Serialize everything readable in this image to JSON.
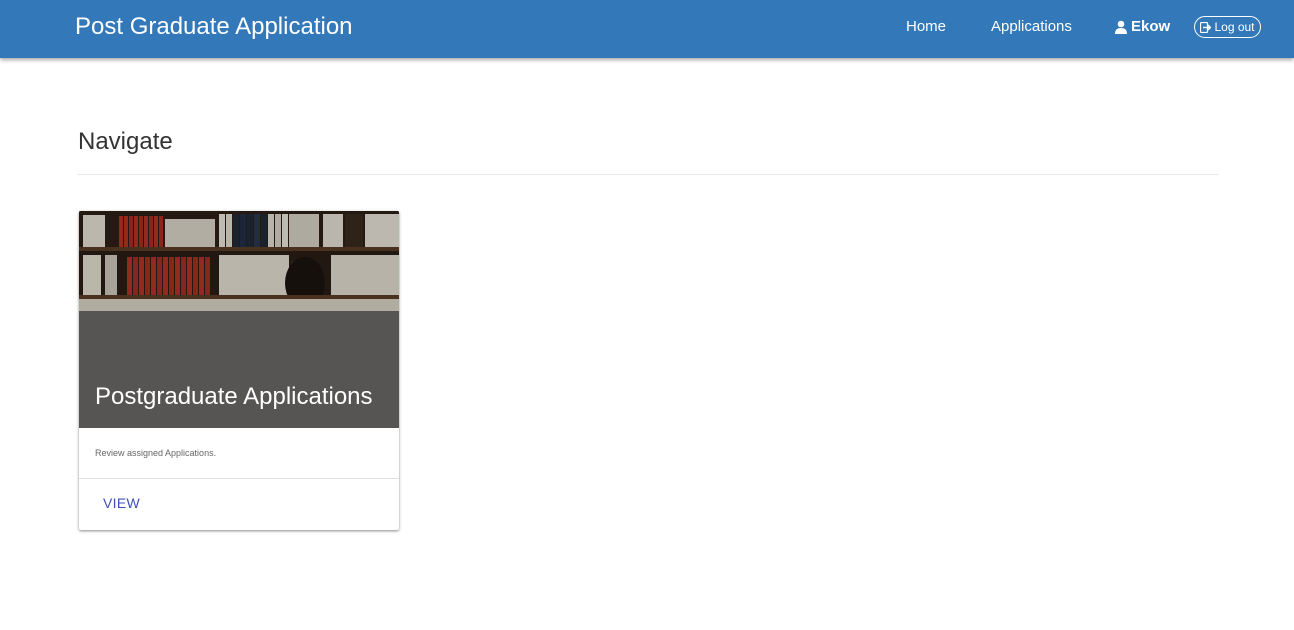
{
  "header": {
    "brand": "Post Graduate Application",
    "nav": {
      "home": "Home",
      "applications": "Applications",
      "user": "Ekow",
      "logout": "Log out"
    },
    "color": "#3378b8"
  },
  "main": {
    "section_title": "Navigate",
    "card": {
      "title": "Postgraduate Applications",
      "text": "Review assigned Applications.",
      "action": "VIEW",
      "overlay_color": "#565554",
      "action_color": "#3f51b5"
    }
  },
  "icons": {
    "user": "user-icon",
    "logout": "logout-icon"
  }
}
